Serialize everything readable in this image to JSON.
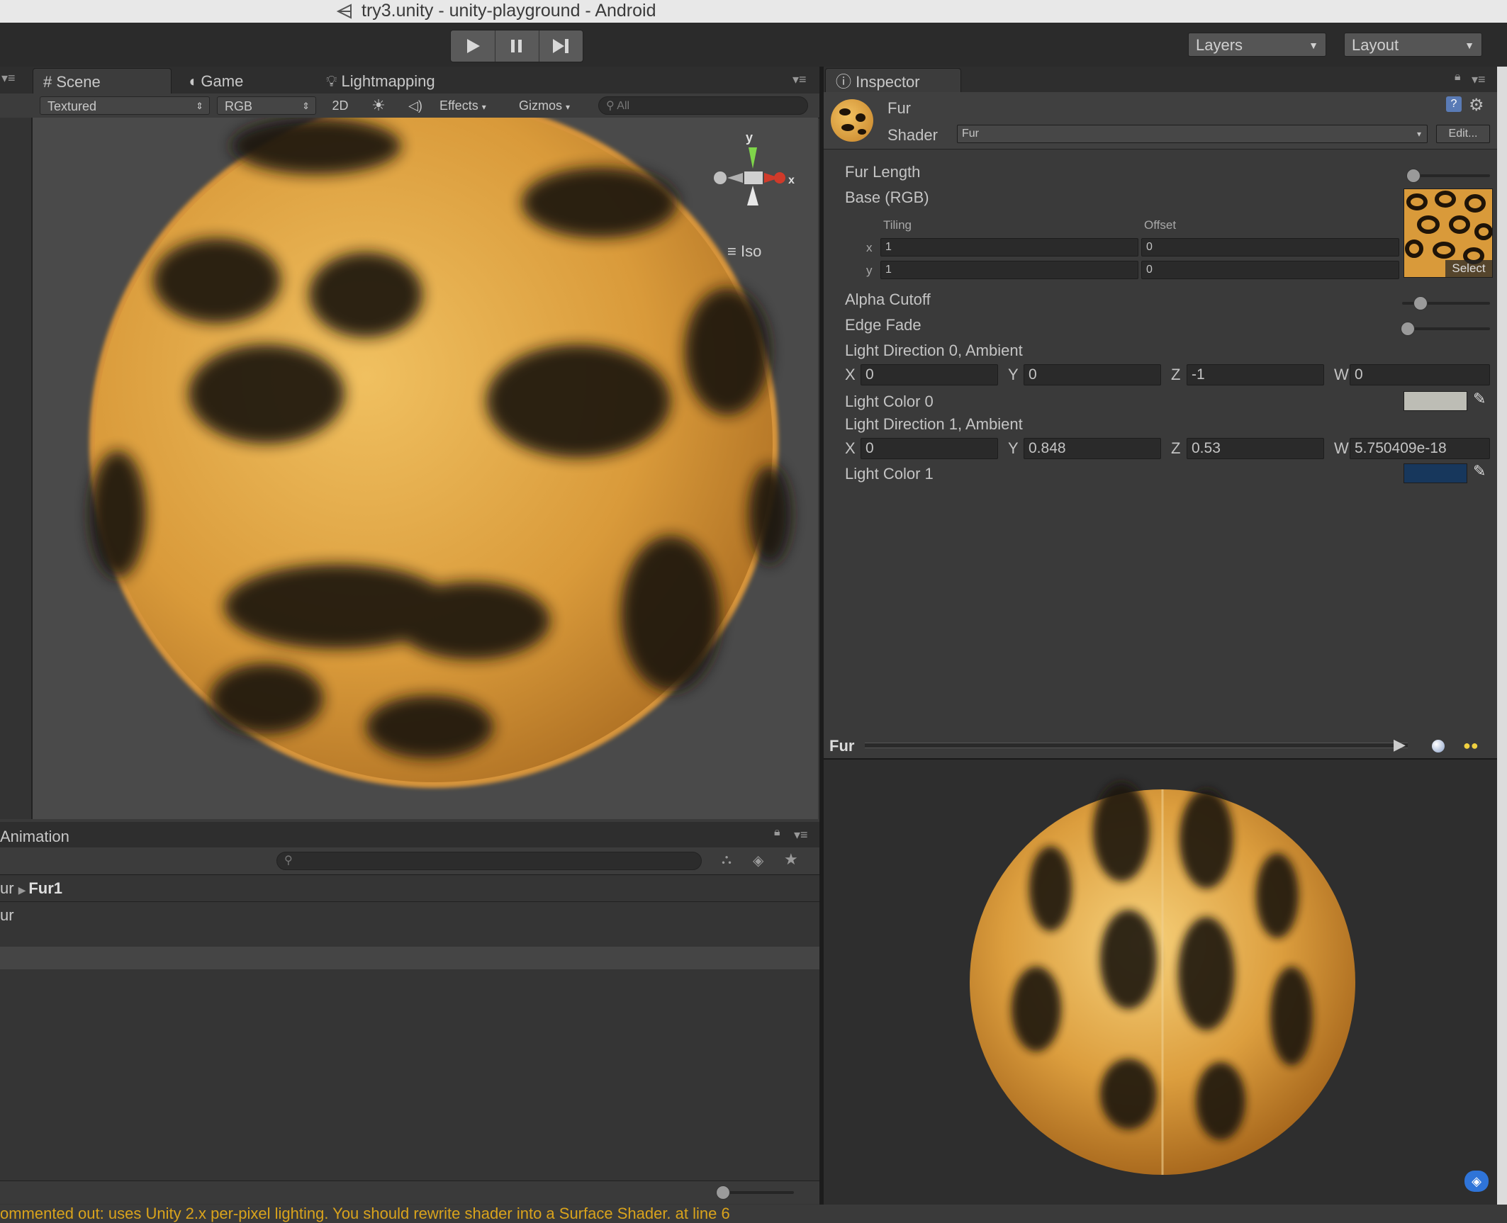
{
  "window": {
    "title": "try3.unity - unity-playground - Android"
  },
  "toolbar": {
    "layers_label": "Layers",
    "layout_label": "Layout"
  },
  "scene_tabs": {
    "scene": "Scene",
    "game": "Game",
    "lightmapping": "Lightmapping"
  },
  "scene_bar": {
    "render_mode": "Textured",
    "channel": "RGB",
    "mode_2d": "2D",
    "effects": "Effects",
    "gizmos": "Gizmos",
    "search_placeholder": "All",
    "gizmo_y": "y",
    "gizmo_x": "x",
    "projection": "Iso"
  },
  "inspector": {
    "tab": "Inspector",
    "material_name": "Fur",
    "shader_label": "Shader",
    "shader_value": "Fur",
    "edit_button": "Edit...",
    "fur_length": "Fur Length",
    "fur_length_value": 0,
    "base_rgb": "Base (RGB)",
    "tiling": "Tiling",
    "offset": "Offset",
    "tiling_x_label": "x",
    "tiling_y_label": "y",
    "tiling_x": "1",
    "tiling_y": "1",
    "offset_x": "0",
    "offset_y": "0",
    "select_button": "Select",
    "alpha_cutoff": "Alpha Cutoff",
    "alpha_cutoff_value": 0.2,
    "edge_fade": "Edge Fade",
    "edge_fade_value": 0.05,
    "light_dir0": "Light Direction 0, Ambient",
    "light_dir0_values": {
      "x_label": "X",
      "y_label": "Y",
      "z_label": "Z",
      "w_label": "W",
      "x": "0",
      "y": "0",
      "z": "-1",
      "w": "0"
    },
    "light_color0": "Light Color 0",
    "light_color0_hex": "#bdbdb5",
    "light_dir1": "Light Direction 1, Ambient",
    "light_dir1_values": {
      "x_label": "X",
      "y_label": "Y",
      "z_label": "Z",
      "w_label": "W",
      "x": "0",
      "y": "0.848",
      "z": "0.53",
      "w": "5.750409e-18"
    },
    "light_color1": "Light Color 1",
    "light_color1_hex": "#17375c"
  },
  "preview": {
    "title": "Fur"
  },
  "animation": {
    "tab": "Animation",
    "breadcrumb_root": "ur",
    "breadcrumb_item": "Fur1",
    "list_item": "ur"
  },
  "console": {
    "message": "ommented out: uses Unity 2.x per-pixel lighting. You should rewrite shader into a Surface Shader. at line 6"
  },
  "colors": {
    "fur_orange": "#d99a3a",
    "spot_dark": "#1f1408",
    "panel_bg": "#3a3a3a",
    "warning": "#d9a31c"
  }
}
